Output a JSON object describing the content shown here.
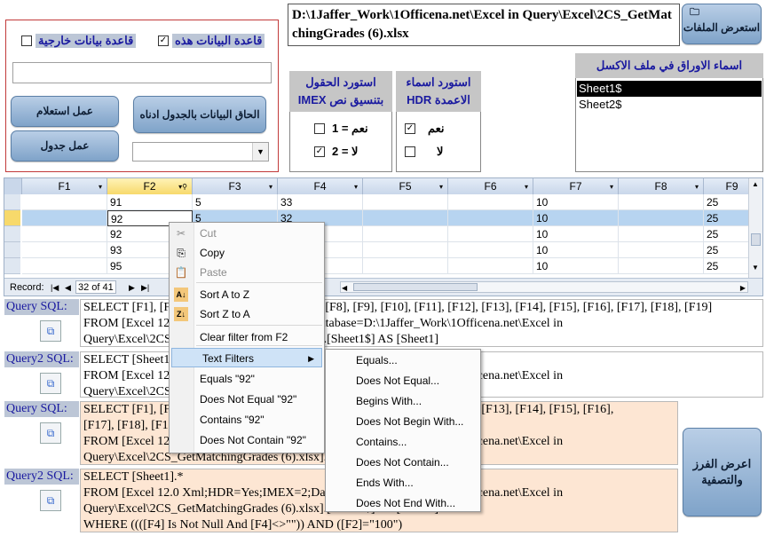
{
  "path_box": {
    "text": "D:\\1Jaffer_Work\\1Officena.net\\Excel in Query\\Excel\\2CS_GetMatchingGrades (6).xlsx"
  },
  "browse_button": {
    "label": "استعرض الملفات"
  },
  "sheets_panel": {
    "title": "اسماء الاوراق في ملف الاكسل",
    "items": [
      "Sheet1$",
      "Sheet2$"
    ],
    "selected": "Sheet1$"
  },
  "hdr_panel": {
    "title": "استورد اسماء الاعمدة HDR",
    "yes_label": "نعم",
    "no_label": "لا",
    "yes_checked": true,
    "no_checked": false
  },
  "imex_panel": {
    "title": "استورد الحقول بتنسيق نص IMEX",
    "opt1_label": "نعم = 1",
    "opt2_label": "لا = 2",
    "opt1_checked": false,
    "opt2_checked": true
  },
  "db_panel": {
    "this_db_label": "قاعدة البيانات هذه",
    "external_db_label": "قاعدة بيانات خارجية",
    "this_db_checked": true,
    "external_db_checked": false,
    "db_path_value": "",
    "append_button": "الحاق البيانات بالجدول ادناه",
    "query_button": "عمل استعلام",
    "table_button": "عمل جدول",
    "combo_value": ""
  },
  "grid": {
    "columns": [
      "F1",
      "F2",
      "F3",
      "F4",
      "F5",
      "F6",
      "F7",
      "F8",
      "F9"
    ],
    "rows": [
      [
        "",
        "91",
        "5",
        "33",
        "",
        "",
        "10",
        "",
        "25"
      ],
      [
        "",
        "92",
        "5",
        "32",
        "",
        "",
        "10",
        "",
        "25"
      ],
      [
        "",
        "92",
        "5",
        "",
        "",
        "",
        "10",
        "",
        "25"
      ],
      [
        "",
        "93",
        "5",
        "",
        "",
        "",
        "10",
        "",
        "25"
      ],
      [
        "",
        "95",
        "5",
        "",
        "",
        "",
        "10",
        "",
        "25"
      ]
    ],
    "record_label": "Record:",
    "record_value": "32 of 41"
  },
  "sql_sections": [
    {
      "label": "Query SQL:",
      "lines": [
        "SELECT  [F1], [F2], [F3], [F4], [F5], [F6], [F7], [F8], [F9], [F10], [F11], [F12], [F13], [F14], [F15], [F16], [F17], [F18], [F19]",
        "FROM [Excel 12.0 Xml;HDR=Yes;IMEX=2;Database=D:\\1Jaffer_Work\\1Officena.net\\Excel in",
        "Query\\Excel\\2CS_GetMatchingGrades (6).xlsx].[Sheet1$] AS [Sheet1]"
      ]
    },
    {
      "label": "Query2 SQL:",
      "lines": [
        "SELECT [Sheet1].*",
        "FROM [Excel 12.0 Xml;HDR=Yes;IMEX=2;Database=D:\\1Jaffer_Work\\1Officena.net\\Excel in",
        "Query\\Excel\\2CS_GetMatchingGrades (6).xlsx].[Sheet1$] AS [Sheet1]"
      ]
    },
    {
      "label": "Query SQL:",
      "lines": [
        "SELECT  [F1], [F2], [F3], [F4], [F5], [F6], [F7], [F8], [F9], [F10], [F11], [F12], [F13], [F14], [F15], [F16],",
        "[F17], [F18], [F19]",
        "FROM [Excel 12.0 Xml;HDR=Yes;IMEX=2;Database=D:\\1Jaffer_Work\\1Officena.net\\Excel in",
        "Query\\Excel\\2CS_GetMatchingGrades (6).xlsx].[Sheet1$] AS [Sheet1]"
      ]
    },
    {
      "label": "Query2 SQL:",
      "lines": [
        "SELECT [Sheet1].*",
        "FROM [Excel 12.0 Xml;HDR=Yes;IMEX=2;Database=D:\\1Jaffer_Work\\1Officena.net\\Excel in",
        "Query\\Excel\\2CS_GetMatchingGrades (6).xlsx].[Sheet1$] AS [Sheet1]",
        "WHERE ((([F4] Is Not Null And [F4]<>\"\")) AND ([F2]=\"100\")"
      ]
    }
  ],
  "sort_filter_button": {
    "label": "اعرض الفرز والتصفية"
  },
  "context_menu": {
    "items": [
      {
        "label": "Cut",
        "icon": "scissors-icon",
        "disabled": true
      },
      {
        "label": "Copy",
        "icon": "copy-icon",
        "disabled": false
      },
      {
        "label": "Paste",
        "icon": "paste-icon",
        "disabled": true
      },
      {
        "label": "Sort A to Z",
        "icon": "sort-asc-icon",
        "disabled": false
      },
      {
        "label": "Sort Z to A",
        "icon": "sort-desc-icon",
        "disabled": false
      },
      {
        "label": "Clear filter from F2",
        "icon": "",
        "disabled": false
      },
      {
        "label": "Text Filters",
        "icon": "",
        "disabled": false
      },
      {
        "label": "Equals \"92\"",
        "icon": "",
        "disabled": false
      },
      {
        "label": "Does Not Equal \"92\"",
        "icon": "",
        "disabled": false
      },
      {
        "label": "Contains \"92\"",
        "icon": "",
        "disabled": false
      },
      {
        "label": "Does Not Contain \"92\"",
        "icon": "",
        "disabled": false
      }
    ]
  },
  "submenu": {
    "items": [
      "Equals...",
      "Does Not Equal...",
      "Begins With...",
      "Does Not Begin With...",
      "Contains...",
      "Does Not Contain...",
      "Ends With...",
      "Does Not End With..."
    ]
  },
  "colors": {
    "accent_blue": "#1a1aa0",
    "panel_header": "#c6c6c6",
    "sql_highlight": "#fde6d3",
    "selected_row": "#b7d4f0",
    "border_red": "#c23a3a"
  }
}
